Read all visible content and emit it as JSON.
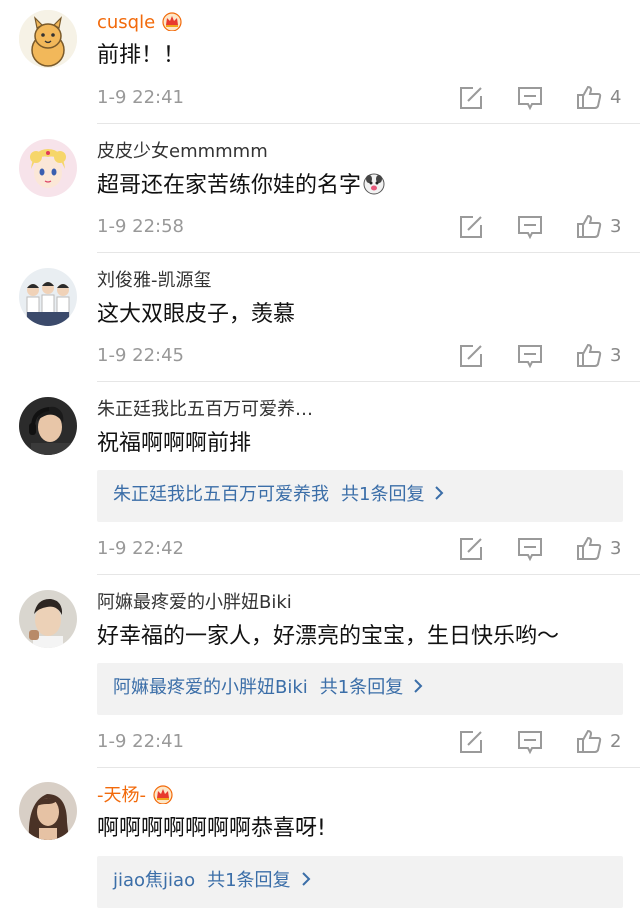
{
  "colors": {
    "vip_username": "#f26a0b",
    "username": "#333333",
    "reply_link": "#3b6ea8",
    "meta": "#999999",
    "icon": "#9a9a9a",
    "reply_bg": "#f2f2f2"
  },
  "comments": [
    {
      "username": "cusqle",
      "vip": true,
      "content": "前排！！",
      "time": "1-9 22:41",
      "likes": "4",
      "avatar": "cartoon-animal-avatar"
    },
    {
      "username": "皮皮少女emmmmm",
      "vip": false,
      "content": "超哥还在家苦练你娃的名字",
      "emoji": "dog-emoji",
      "time": "1-9 22:58",
      "likes": "3",
      "avatar": "anime-girl-avatar"
    },
    {
      "username": "刘俊雅-凯源玺",
      "vip": false,
      "content": "这大双眼皮子，羡慕",
      "time": "1-9 22:45",
      "likes": "3",
      "avatar": "three-boys-avatar"
    },
    {
      "username": "朱正廷我比五百万可爱养…",
      "vip": false,
      "content": "祝福啊啊啊前排",
      "reply": {
        "author": "朱正廷我比五百万可爱养我",
        "count_label": "共1条回复"
      },
      "time": "1-9 22:42",
      "likes": "3",
      "avatar": "young-man-headphones-avatar"
    },
    {
      "username": "阿嫲最疼爱的小胖妞Biki",
      "vip": false,
      "content": "好幸福的一家人，好漂亮的宝宝，生日快乐哟～",
      "reply": {
        "author": "阿嫲最疼爱的小胖妞Biki",
        "count_label": "共1条回复"
      },
      "time": "1-9 22:41",
      "likes": "2",
      "avatar": "young-man-portrait-avatar"
    },
    {
      "username": "-天杨-",
      "vip": true,
      "content": "啊啊啊啊啊啊啊恭喜呀!",
      "reply": {
        "author": "jiao焦jiao",
        "count_label": "共1条回复"
      },
      "avatar": "woman-portrait-avatar"
    }
  ],
  "actions": {
    "share_icon": "share-edit-icon",
    "comment_icon": "comment-bubble-icon",
    "like_icon": "thumbs-up-icon"
  }
}
